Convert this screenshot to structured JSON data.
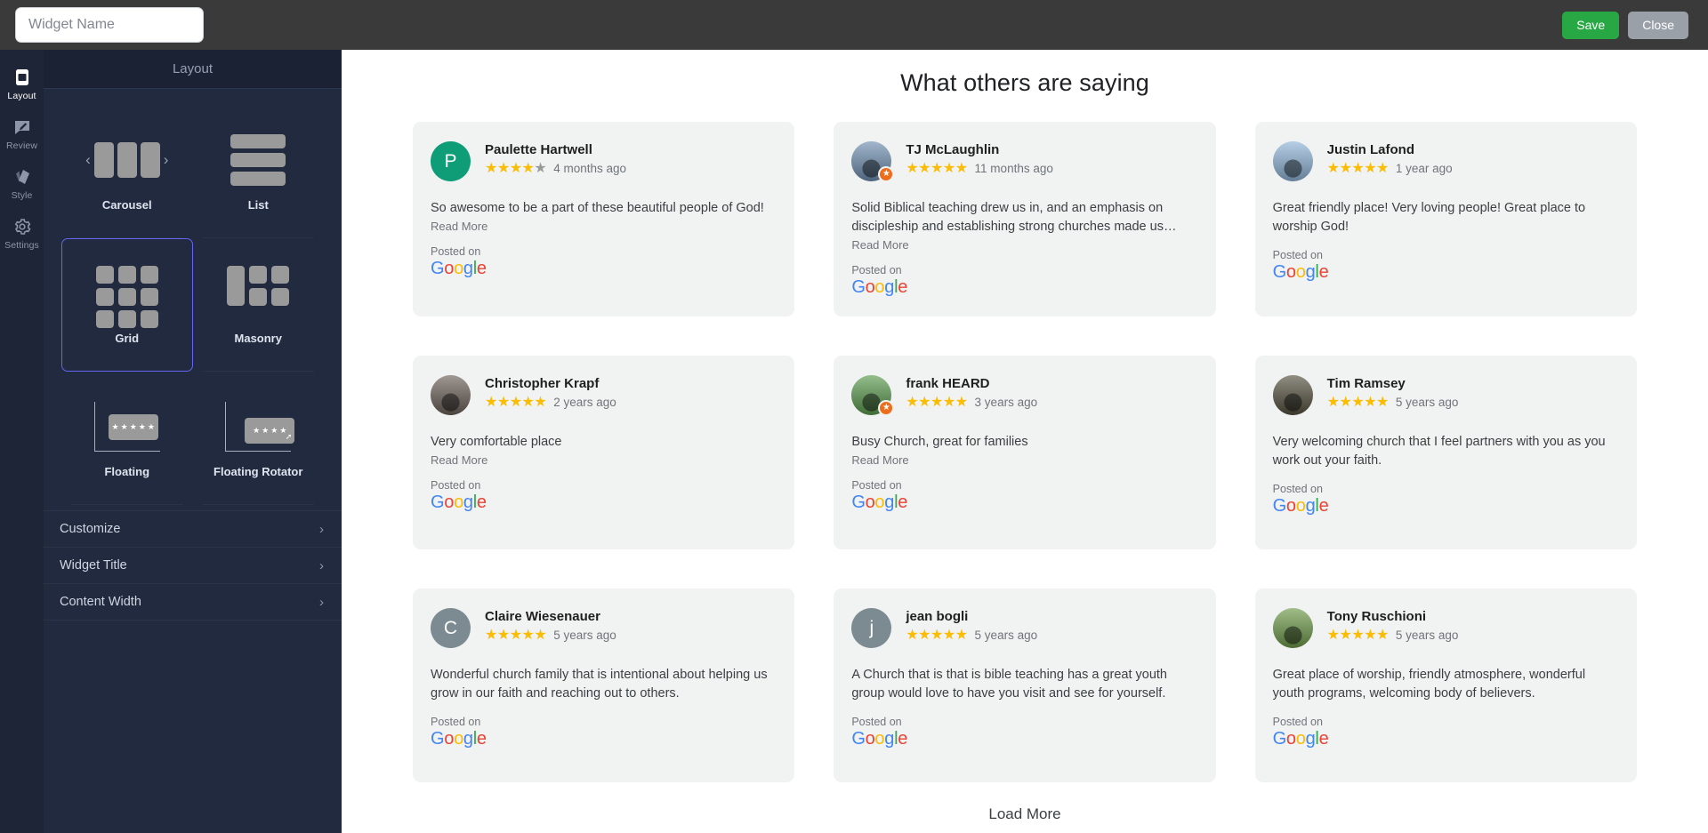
{
  "topbar": {
    "widget_name_placeholder": "Widget Name",
    "widget_name_value": "",
    "save_label": "Save",
    "close_label": "Close"
  },
  "rail": {
    "items": [
      {
        "label": "Layout",
        "icon": "layout-icon",
        "active": true
      },
      {
        "label": "Review",
        "icon": "review-icon",
        "active": false
      },
      {
        "label": "Style",
        "icon": "style-icon",
        "active": false
      },
      {
        "label": "Settings",
        "icon": "gear-icon",
        "active": false
      }
    ]
  },
  "panel": {
    "header": "Layout",
    "layouts": [
      {
        "name": "Carousel",
        "selected": false
      },
      {
        "name": "List",
        "selected": false
      },
      {
        "name": "Grid",
        "selected": true
      },
      {
        "name": "Masonry",
        "selected": false
      },
      {
        "name": "Floating",
        "selected": false
      },
      {
        "name": "Floating Rotator",
        "selected": false
      }
    ],
    "accordion": [
      {
        "label": "Customize"
      },
      {
        "label": "Widget Title"
      },
      {
        "label": "Content Width"
      }
    ],
    "chevron": "›"
  },
  "preview": {
    "title": "What others are saying",
    "load_more": "Load More",
    "read_more_label": "Read More",
    "posted_on_label": "Posted on",
    "source_name": "Google",
    "star_on_color": "#fbbc04",
    "star_off_color": "#9a9a9a",
    "reviews": [
      {
        "author": "Paulette Hartwell",
        "rating": 4,
        "date": "4 months ago",
        "text": "So awesome to be a part of these beautiful people of God!",
        "has_read_more": true,
        "avatar_type": "initial",
        "avatar_letter": "P",
        "avatar_color": "#0f9d77",
        "verified_badge": false
      },
      {
        "author": "TJ McLaughlin",
        "rating": 5,
        "date": "11 months ago",
        "text": "Solid Biblical teaching drew us in, and an emphasis on discipleship and establishing strong churches made us…",
        "has_read_more": true,
        "avatar_type": "photo",
        "avatar_letter": "",
        "avatar_color": "#6f8fb0",
        "verified_badge": true
      },
      {
        "author": "Justin Lafond",
        "rating": 5,
        "date": "1 year ago",
        "text": "Great friendly place! Very loving people! Great place to worship God!",
        "has_read_more": false,
        "avatar_type": "photo",
        "avatar_letter": "",
        "avatar_color": "#8fb5d8",
        "verified_badge": false
      },
      {
        "author": "Christopher Krapf",
        "rating": 5,
        "date": "2 years ago",
        "text": "Very comfortable place",
        "has_read_more": true,
        "avatar_type": "photo",
        "avatar_letter": "",
        "avatar_color": "#6b6058",
        "verified_badge": false
      },
      {
        "author": "frank HEARD",
        "rating": 5,
        "date": "3 years ago",
        "text": "Busy Church, great for families",
        "has_read_more": true,
        "avatar_type": "photo",
        "avatar_letter": "",
        "avatar_color": "#5a9a4e",
        "verified_badge": true
      },
      {
        "author": "Tim Ramsey",
        "rating": 5,
        "date": "5 years ago",
        "text": "Very welcoming church that I feel partners with you as you work out your faith.",
        "has_read_more": false,
        "avatar_type": "photo",
        "avatar_letter": "",
        "avatar_color": "#55503f",
        "verified_badge": false
      },
      {
        "author": "Claire Wiesenauer",
        "rating": 5,
        "date": "5 years ago",
        "text": "Wonderful church family that is intentional about helping us grow in our faith and reaching out to others.",
        "has_read_more": false,
        "avatar_type": "initial",
        "avatar_letter": "C",
        "avatar_color": "#7c8b91",
        "verified_badge": false
      },
      {
        "author": "jean bogli",
        "rating": 5,
        "date": "5 years ago",
        "text": "A Church that is that is bible teaching has a great youth group would love to have you visit and see for yourself.",
        "has_read_more": false,
        "avatar_type": "initial",
        "avatar_letter": "j",
        "avatar_color": "#7c8b91",
        "verified_badge": false
      },
      {
        "author": "Tony Ruschioni",
        "rating": 5,
        "date": "5 years ago",
        "text": "Great place of worship, friendly atmosphere, wonderful youth programs, welcoming body of believers.",
        "has_read_more": false,
        "avatar_type": "photo",
        "avatar_letter": "",
        "avatar_color": "#6e9a4a",
        "verified_badge": false
      }
    ]
  }
}
